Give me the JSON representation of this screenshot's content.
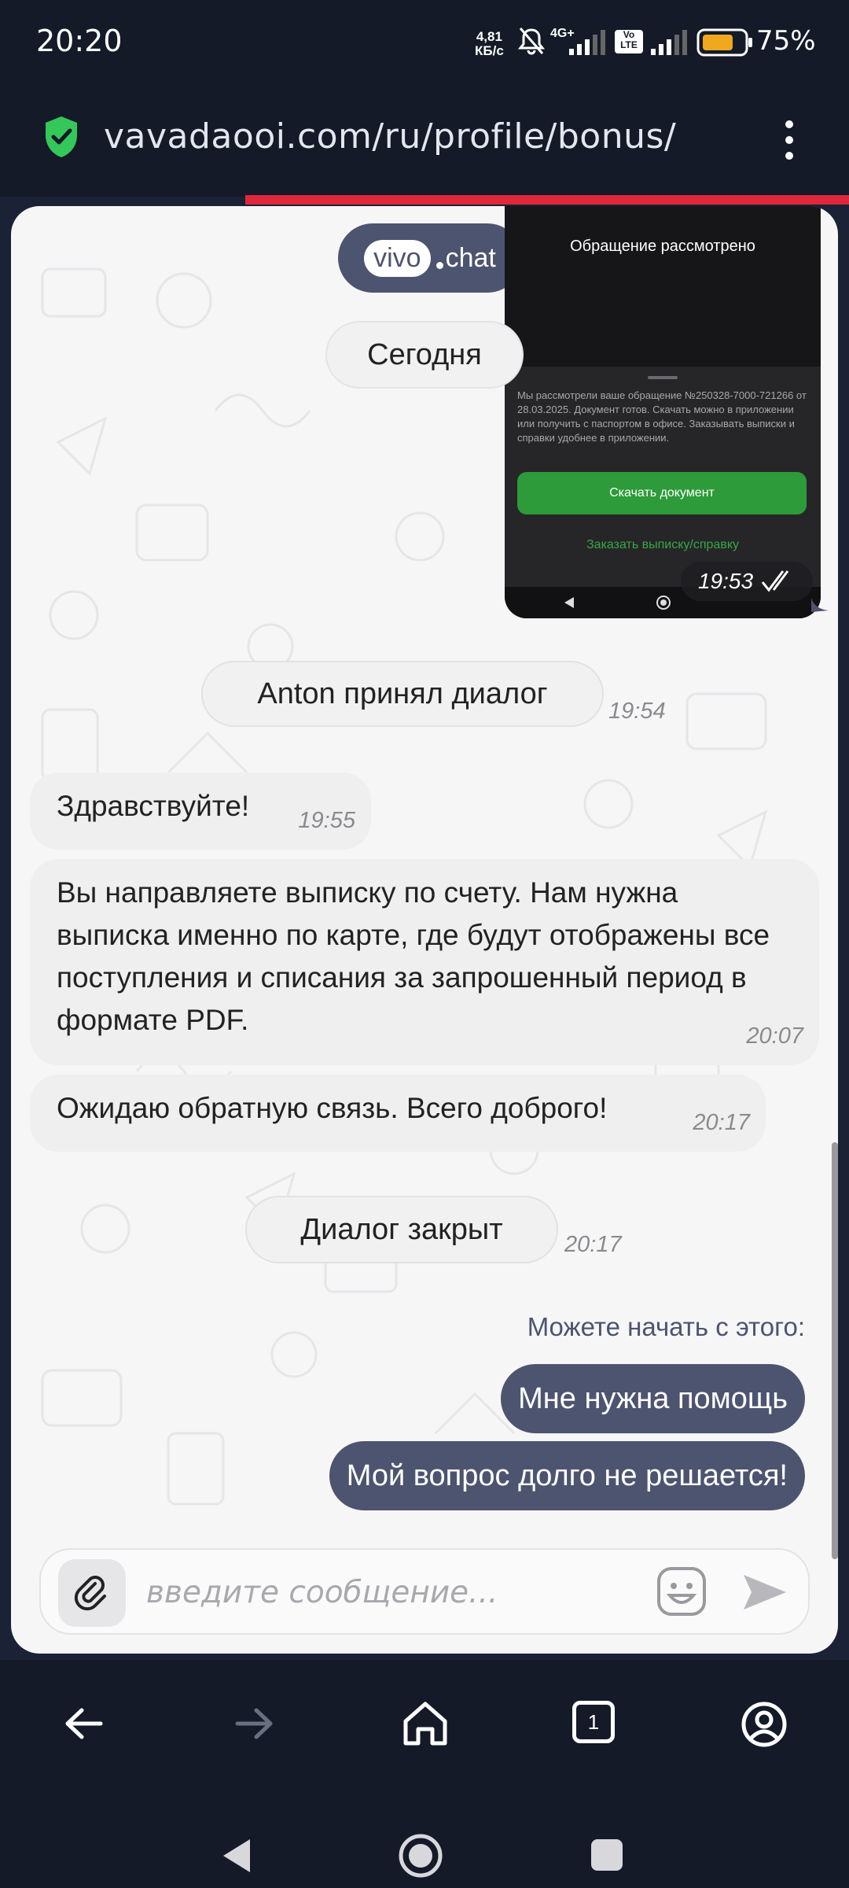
{
  "status_bar": {
    "time": "20:20",
    "net_speed_value": "4,81",
    "net_speed_unit": "КБ/с",
    "network_type": "4G+",
    "volte": "Vo LTE",
    "battery_percent": "75%",
    "battery_level": 0.75
  },
  "browser": {
    "url": "vavadaooi.com/ru/profile/bonus/"
  },
  "chat": {
    "logo_left": "vivo",
    "logo_right": "chat",
    "date_separator": "Сегодня",
    "image_message": {
      "title": "Обращение рассмотрено",
      "body": "Мы рассмотрели ваше обращение №250328-7000-721266 от 28.03.2025. Документ готов. Скачать можно в приложении или получить с паспортом в офисе. Заказывать выписки и справки удобнее в приложении.",
      "button": "Скачать документ",
      "link": "Заказать выписку/справку",
      "time": "19:53"
    },
    "system_accepted": {
      "text": "Anton принял диалог",
      "time": "19:54"
    },
    "messages": [
      {
        "text": "Здравствуйте!",
        "time": "19:55"
      },
      {
        "text": "Вы направляете выписку по счету. Нам нужна выписка именно по карте, где будут отображены все поступления и списания за запрошенный период в формате PDF.",
        "time": "20:07"
      },
      {
        "text": "Ожидаю обратную связь. Всего доброго!",
        "time": "20:17"
      }
    ],
    "system_closed": {
      "text": "Диалог закрыт",
      "time": "20:17"
    },
    "quick_replies_label": "Можете начать с этого:",
    "quick_replies": [
      "Мне нужна помощь",
      "Мой вопрос долго не решается!"
    ],
    "input_placeholder": "введите сообщение..."
  },
  "bottom_nav": {
    "tab_count": "1"
  },
  "icons": {
    "secure": "shield-check-icon",
    "menu": "kebab-menu-icon",
    "attach": "paperclip-icon",
    "emoji": "emoji-icon",
    "send": "send-icon",
    "back": "arrow-left-icon",
    "forward": "arrow-right-icon",
    "home": "home-icon",
    "tabs": "tabs-icon",
    "profile": "profile-icon"
  },
  "colors": {
    "accent": "#4d546f",
    "secure_green": "#34c759",
    "brand_red": "#e0283c"
  }
}
